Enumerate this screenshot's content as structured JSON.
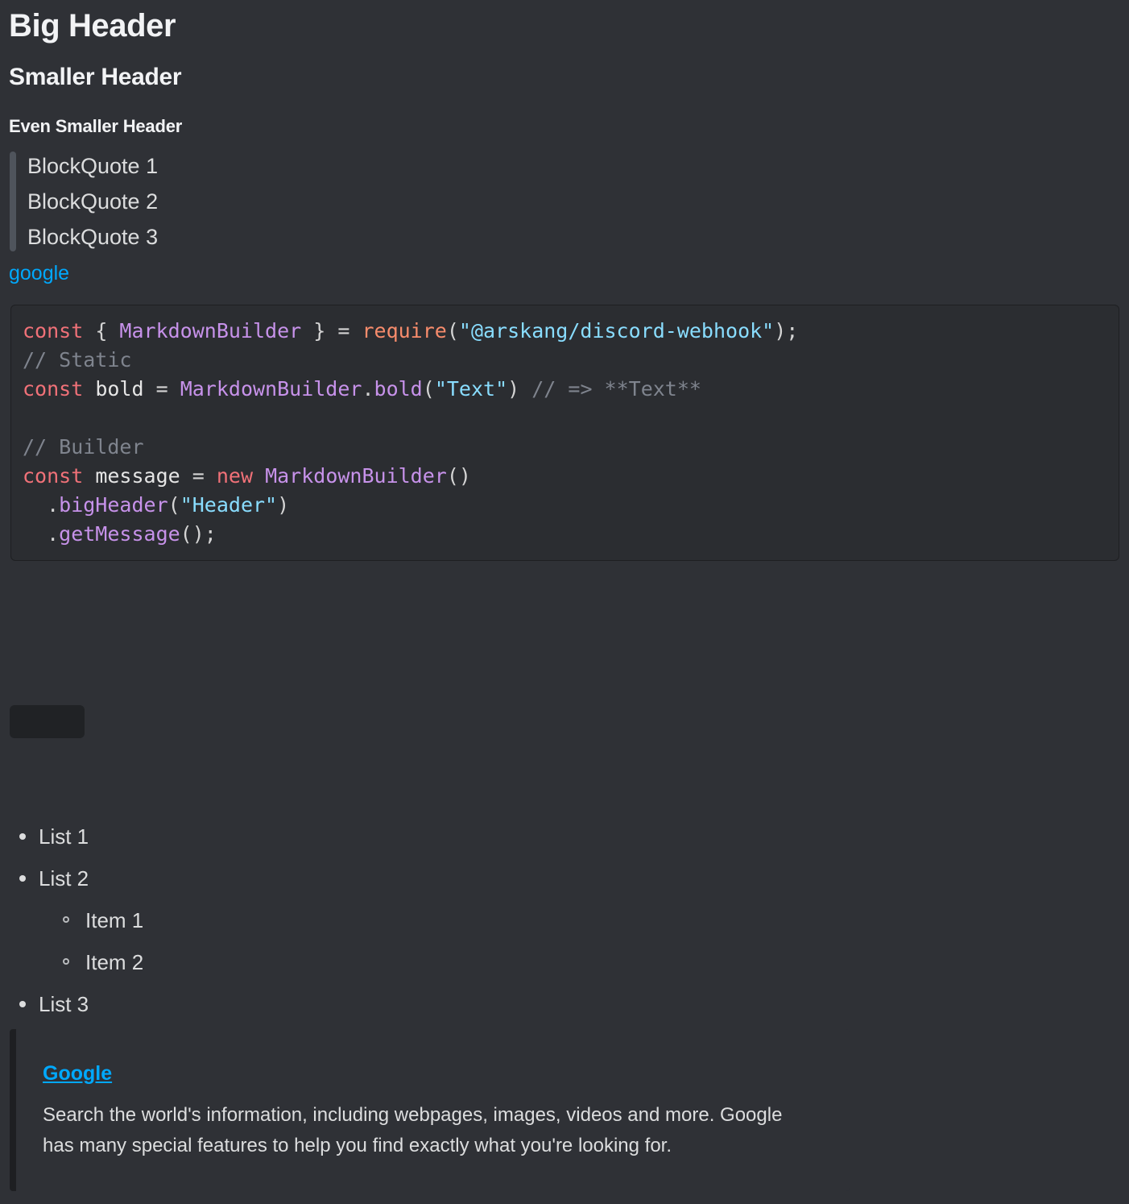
{
  "headers": {
    "big": "Big Header",
    "smaller": "Smaller Header",
    "even_smaller": "Even Smaller Header"
  },
  "blockquote": {
    "lines": [
      "BlockQuote 1",
      "BlockQuote 2",
      "BlockQuote 3"
    ]
  },
  "link": {
    "label": "google"
  },
  "code_block": {
    "language": "javascript",
    "lines": [
      {
        "tokens": [
          {
            "t": "const",
            "c": "kw"
          },
          {
            "t": " { ",
            "c": "punc"
          },
          {
            "t": "MarkdownBuilder",
            "c": "cls"
          },
          {
            "t": " } ",
            "c": "punc"
          },
          {
            "t": "= ",
            "c": "punc"
          },
          {
            "t": "require",
            "c": "req"
          },
          {
            "t": "(",
            "c": "punc"
          },
          {
            "t": "\"@arskang/discord-webhook\"",
            "c": "str"
          },
          {
            "t": ");",
            "c": "punc"
          }
        ]
      },
      {
        "tokens": [
          {
            "t": "// Static",
            "c": "cmt"
          }
        ]
      },
      {
        "tokens": [
          {
            "t": "const",
            "c": "kw"
          },
          {
            "t": " bold ",
            "c": "plain"
          },
          {
            "t": "= ",
            "c": "punc"
          },
          {
            "t": "MarkdownBuilder",
            "c": "cls"
          },
          {
            "t": ".",
            "c": "punc"
          },
          {
            "t": "bold",
            "c": "fn"
          },
          {
            "t": "(",
            "c": "punc"
          },
          {
            "t": "\"Text\"",
            "c": "str"
          },
          {
            "t": ") ",
            "c": "punc"
          },
          {
            "t": "// => **Text**",
            "c": "cmt"
          }
        ]
      },
      {
        "tokens": [
          {
            "t": "",
            "c": "plain"
          }
        ]
      },
      {
        "tokens": [
          {
            "t": "// Builder",
            "c": "cmt"
          }
        ]
      },
      {
        "tokens": [
          {
            "t": "const",
            "c": "kw"
          },
          {
            "t": " message ",
            "c": "plain"
          },
          {
            "t": "= ",
            "c": "punc"
          },
          {
            "t": "new",
            "c": "kw"
          },
          {
            "t": " ",
            "c": "plain"
          },
          {
            "t": "MarkdownBuilder",
            "c": "cls"
          },
          {
            "t": "()",
            "c": "punc"
          }
        ]
      },
      {
        "tokens": [
          {
            "t": "  .",
            "c": "punc"
          },
          {
            "t": "bigHeader",
            "c": "fn"
          },
          {
            "t": "(",
            "c": "punc"
          },
          {
            "t": "\"Header\"",
            "c": "str"
          },
          {
            "t": ")",
            "c": "punc"
          }
        ]
      },
      {
        "tokens": [
          {
            "t": "  .",
            "c": "punc"
          },
          {
            "t": "getMessage",
            "c": "fn"
          },
          {
            "t": "();",
            "c": "punc"
          }
        ]
      }
    ]
  },
  "inline_code": {
    "value": ""
  },
  "lists": {
    "items": [
      {
        "label": "List 1",
        "children": []
      },
      {
        "label": "List 2",
        "children": [
          "Item 1",
          "Item 2"
        ]
      },
      {
        "label": "List 3",
        "children": []
      }
    ]
  },
  "embed": {
    "title": "Google",
    "description": "Search the world's information, including webpages, images, videos and more. Google has many special features to help you find exactly what you're looking for.",
    "accent_color": "#1e1f22",
    "title_color": "#00a8fc"
  },
  "theme": {
    "background": "#2f3136",
    "code_background": "#2b2d31",
    "code_border": "#1e1f22",
    "text": "#dcddde",
    "header_text": "#f2f3f5",
    "link": "#00a8fc",
    "quote_bar": "#4f545c"
  }
}
